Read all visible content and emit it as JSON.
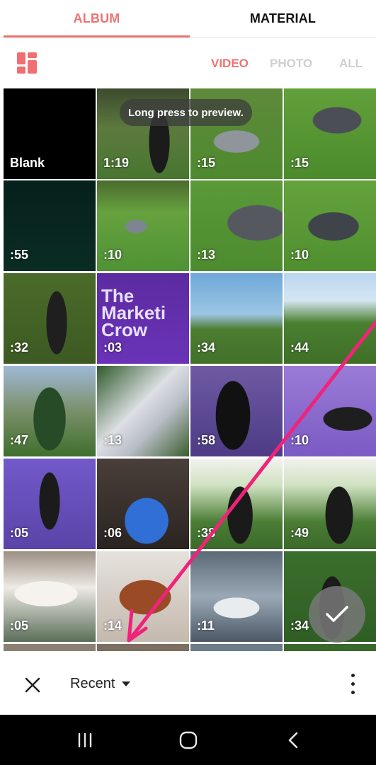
{
  "tabs": {
    "album": "ALBUM",
    "material": "MATERIAL",
    "active": "album"
  },
  "filters": {
    "video": "VIDEO",
    "photo": "PHOTO",
    "all": "ALL",
    "active": "video"
  },
  "icons": {
    "layout": "layout-grid-icon",
    "close": "close-icon",
    "dropdown": "caret-down-icon",
    "more": "more-vertical-icon",
    "confirm": "check-icon",
    "nav_recents": "recents-icon",
    "nav_home": "home-icon",
    "nav_back": "back-icon"
  },
  "colors": {
    "accent": "#ef7373",
    "inactive": "#cfcfcf",
    "annotation_arrow": "#f0237a"
  },
  "toast": "Long press to preview.",
  "grid": {
    "items": [
      {
        "label": "Blank"
      },
      {
        "label": "1:19"
      },
      {
        "label": ":15"
      },
      {
        "label": ":15"
      },
      {
        "label": ":55"
      },
      {
        "label": ":10"
      },
      {
        "label": ":13"
      },
      {
        "label": ":10"
      },
      {
        "label": ":32"
      },
      {
        "label": ":03",
        "overlay_text": "The Marketi Crow"
      },
      {
        "label": ":34"
      },
      {
        "label": ":44"
      },
      {
        "label": ":47"
      },
      {
        "label": ":13"
      },
      {
        "label": ":58"
      },
      {
        "label": ":10"
      },
      {
        "label": ":05"
      },
      {
        "label": ":06"
      },
      {
        "label": ":38"
      },
      {
        "label": ":49"
      },
      {
        "label": ":05"
      },
      {
        "label": ":14"
      },
      {
        "label": ":11"
      },
      {
        "label": ":34"
      }
    ]
  },
  "bottom_bar": {
    "album_selector": "Recent"
  }
}
